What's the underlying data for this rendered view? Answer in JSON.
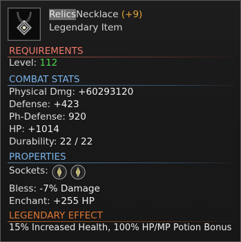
{
  "item": {
    "name_highlighted": "Relics",
    "name_rest": "Necklace",
    "plus": "(+9)",
    "rarity": "Legendary Item",
    "icon": "necklace-icon"
  },
  "requirements": {
    "header": "REQUIREMENTS",
    "level_label": "Level:",
    "level_value": "112"
  },
  "combat_stats": {
    "header": "COMBAT STATS",
    "physical_dmg_label": "Physical Dmg:",
    "physical_dmg_value": "+60293120",
    "defense_label": "Defense:",
    "defense_value": "+423",
    "ph_defense_label": "Ph-Defense:",
    "ph_defense_value": "920",
    "hp_label": "HP:",
    "hp_value": "+1014",
    "durability_label": "Durability:",
    "durability_value": "22 / 22"
  },
  "properties": {
    "header": "PROPERTIES",
    "sockets_label": "Sockets:",
    "sockets": [
      {
        "icon": "socket-gem-icon"
      },
      {
        "icon": "socket-gem-icon"
      }
    ],
    "bless_label": "Bless:",
    "bless_value": "-7% Damage",
    "enchant_label": "Enchant:",
    "enchant_value": "+255 HP"
  },
  "legendary_effect": {
    "header": "LEGENDARY EFFECT",
    "text": "15% Increased Health, 100% HP/MP Potion Bonus"
  },
  "colors": {
    "requirements": "#f07a6a",
    "stats": "#7ab4ea",
    "legendary": "#e07832",
    "plus": "#e6a53a",
    "level_value": "#4ed64e"
  }
}
